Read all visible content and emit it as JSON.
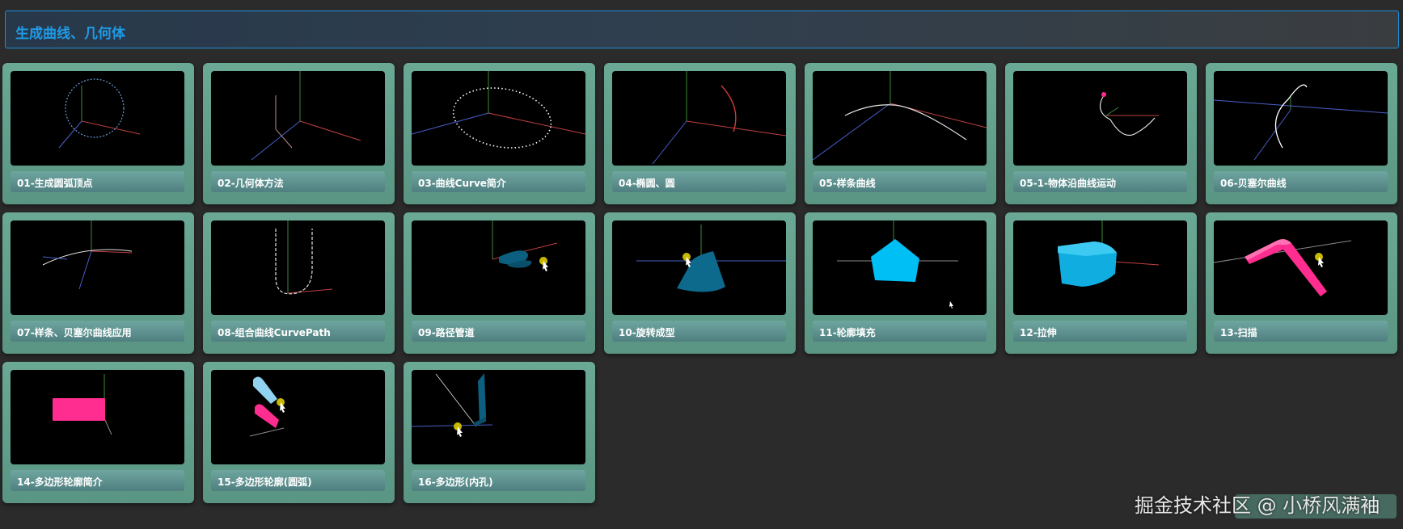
{
  "header": {
    "title": "生成曲线、几何体"
  },
  "cards": [
    {
      "label": "01-生成圆弧顶点",
      "scene": "circle-arc"
    },
    {
      "label": "02-几何体方法",
      "scene": "axes-lines"
    },
    {
      "label": "03-曲线Curve简介",
      "scene": "ellipse-dots"
    },
    {
      "label": "04-椭圆、圆",
      "scene": "arc-axes"
    },
    {
      "label": "05-样条曲线",
      "scene": "spline"
    },
    {
      "label": "05-1-物体沿曲线运动",
      "scene": "moving-object"
    },
    {
      "label": "06-贝塞尔曲线",
      "scene": "bezier"
    },
    {
      "label": "07-样条、贝塞尔曲线应用",
      "scene": "spline-bezier"
    },
    {
      "label": "08-组合曲线CurvePath",
      "scene": "curve-path"
    },
    {
      "label": "09-路径管道",
      "scene": "tube"
    },
    {
      "label": "10-旋转成型",
      "scene": "lathe"
    },
    {
      "label": "11-轮廓填充",
      "scene": "shape-fill"
    },
    {
      "label": "12-拉伸",
      "scene": "extrude"
    },
    {
      "label": "13-扫描",
      "scene": "sweep"
    },
    {
      "label": "14-多边形轮廓简介",
      "scene": "polygon-outline"
    },
    {
      "label": "15-多边形轮廓(圆弧)",
      "scene": "polygon-arc"
    },
    {
      "label": "16-多边形(内孔)",
      "scene": "polygon-hole"
    }
  ],
  "watermark": "掘金技术社区 @ 小桥风满袖",
  "colors": {
    "background": "#2b2b2b",
    "header_border": "#1e8fd6",
    "header_title": "#1e9be8",
    "card": "#5f9e8c",
    "mesh_cyan": "#16b8f0",
    "mesh_pink": "#ff2d8f",
    "mesh_teal": "#0d5f80"
  }
}
